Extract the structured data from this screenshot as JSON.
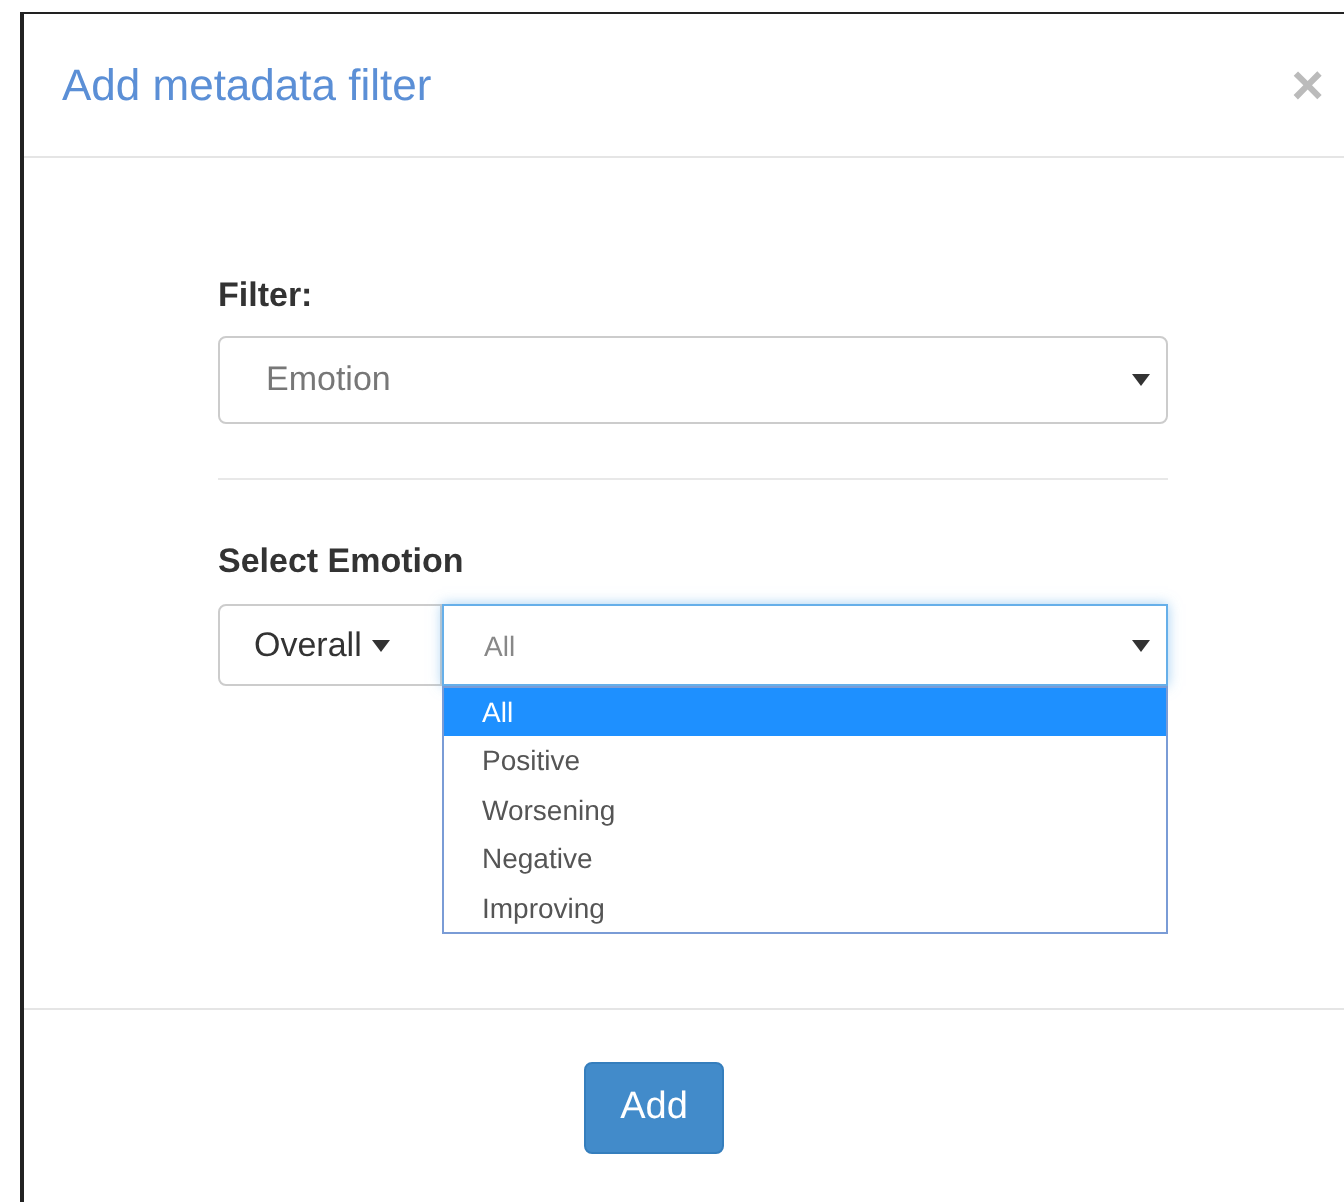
{
  "dialog": {
    "title": "Add metadata filter",
    "close": "×"
  },
  "filter": {
    "label": "Filter:",
    "value": "Emotion"
  },
  "emotion": {
    "label": "Select Emotion",
    "scope": "Overall",
    "value": "All",
    "expanded": true,
    "options": [
      {
        "label": "All",
        "selected": true
      },
      {
        "label": "Positive",
        "selected": false
      },
      {
        "label": "Worsening",
        "selected": false
      },
      {
        "label": "Negative",
        "selected": false
      },
      {
        "label": "Improving",
        "selected": false
      }
    ]
  },
  "buttons": [
    "Add"
  ]
}
